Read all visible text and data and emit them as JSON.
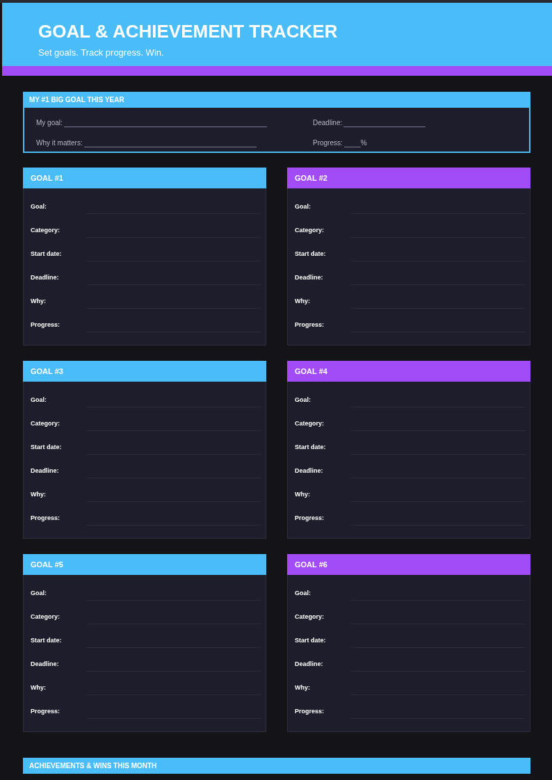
{
  "header": {
    "title": "GOAL & ACHIEVEMENT TRACKER",
    "subtitle": "Set goals. Track progress. Win."
  },
  "big_goal": {
    "title": "MY #1 BIG GOAL THIS YEAR",
    "fields": [
      {
        "label": "My goal:"
      },
      {
        "label": "Deadline:"
      },
      {
        "label": "Why it matters:"
      },
      {
        "label": "Progress:",
        "suffix": "%"
      }
    ]
  },
  "goals": [
    {
      "title": "GOAL #1",
      "color": "#4abdf8",
      "fields": [
        "Goal:",
        "Category:",
        "Start date:",
        "Deadline:",
        "Why:",
        "Progress:"
      ]
    },
    {
      "title": "GOAL #2",
      "color": "#a14cf7",
      "fields": [
        "Goal:",
        "Category:",
        "Start date:",
        "Deadline:",
        "Why:",
        "Progress:"
      ]
    },
    {
      "title": "GOAL #3",
      "color": "#4abdf8",
      "fields": [
        "Goal:",
        "Category:",
        "Start date:",
        "Deadline:",
        "Why:",
        "Progress:"
      ]
    },
    {
      "title": "GOAL #4",
      "color": "#a14cf7",
      "fields": [
        "Goal:",
        "Category:",
        "Start date:",
        "Deadline:",
        "Why:",
        "Progress:"
      ]
    },
    {
      "title": "GOAL #5",
      "color": "#4abdf8",
      "fields": [
        "Goal:",
        "Category:",
        "Start date:",
        "Deadline:",
        "Why:",
        "Progress:"
      ]
    },
    {
      "title": "GOAL #6",
      "color": "#a14cf7",
      "fields": [
        "Goal:",
        "Category:",
        "Start date:",
        "Deadline:",
        "Why:",
        "Progress:"
      ]
    }
  ],
  "achievements": {
    "title": "ACHIEVEMENTS & WINS THIS MONTH"
  }
}
